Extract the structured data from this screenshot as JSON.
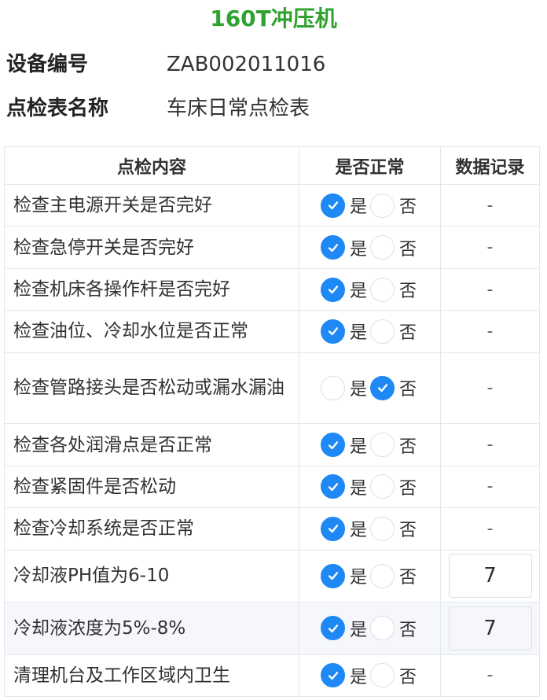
{
  "header": {
    "title": "160T冲压机"
  },
  "info": {
    "device_no_label": "设备编号",
    "device_no_value": "ZAB002011016",
    "sheet_name_label": "点检表名称",
    "sheet_name_value": "车床日常点检表"
  },
  "table": {
    "headers": [
      "点检内容",
      "是否正常",
      "数据记录"
    ],
    "option_yes": "是",
    "option_no": "否",
    "rows": [
      {
        "content": "检查主电源开关是否完好",
        "selected": "是",
        "record": "-"
      },
      {
        "content": "检查急停开关是否完好",
        "selected": "是",
        "record": "-"
      },
      {
        "content": "检查机床各操作杆是否完好",
        "selected": "是",
        "record": "-"
      },
      {
        "content": "检查油位、冷却水位是否正常",
        "selected": "是",
        "record": "-"
      },
      {
        "content": "检查管路接头是否松动或漏水漏油",
        "selected": "否",
        "record": "-"
      },
      {
        "content": "检查各处润滑点是否正常",
        "selected": "是",
        "record": "-"
      },
      {
        "content": "检查紧固件是否松动",
        "selected": "是",
        "record": "-"
      },
      {
        "content": "检查冷却系统是否正常",
        "selected": "是",
        "record": "-"
      },
      {
        "content": "冷却液PH值为6-10",
        "selected": "是",
        "record": "7"
      },
      {
        "content": "冷却液浓度为5%-8%",
        "selected": "是",
        "record": "7"
      },
      {
        "content": "清理机台及工作区域内卫生",
        "selected": "是",
        "record": "-"
      }
    ]
  },
  "colors": {
    "title": "#2fa22f",
    "radio_checked": "#1e88f5",
    "border": "#e4e7ed"
  },
  "icons": {
    "checked": "check-icon"
  }
}
